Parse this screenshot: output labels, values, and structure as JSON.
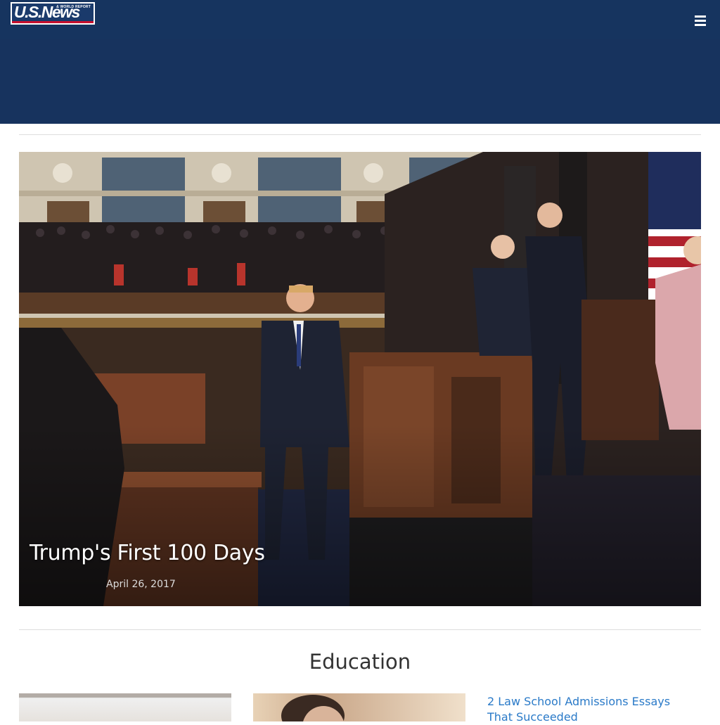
{
  "header": {
    "logo_text": "U.S.News",
    "logo_subtext": "& WORLD REPORT",
    "menu_icon": "hamburger-menu-icon"
  },
  "hero": {
    "title": "Trump's First 100 Days",
    "date": "April 26, 2017"
  },
  "section": {
    "title": "Education"
  },
  "articles": [
    {
      "title": "2 Law School Admissions Essays That Succeeded"
    }
  ],
  "colors": {
    "header_bg": "#16345f",
    "link": "#2a7ac8"
  }
}
